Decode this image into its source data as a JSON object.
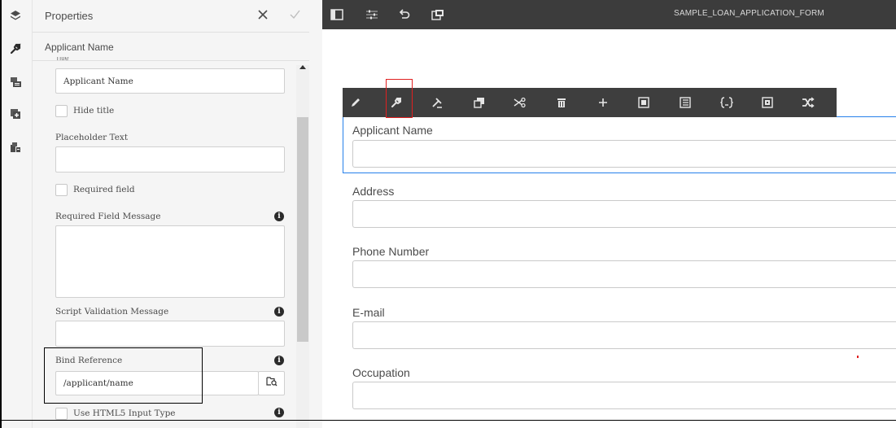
{
  "panel": {
    "title": "Properties",
    "subtitle": "Applicant Name",
    "cut_label": "Title",
    "fields": {
      "title_value": "Applicant Name",
      "hide_title_label": "Hide title",
      "placeholder_label": "Placeholder Text",
      "placeholder_value": "",
      "required_label": "Required field",
      "required_msg_label": "Required Field Message",
      "script_msg_label": "Script Validation Message",
      "bind_ref_label": "Bind Reference",
      "bind_ref_value": "/applicant/name",
      "html5_label": "Use HTML5 Input Type"
    }
  },
  "rail": {
    "icons": [
      "layers-icon",
      "wrench-icon",
      "components-icon",
      "add-asset-icon",
      "data-sources-icon"
    ]
  },
  "editor": {
    "form_title": "SAMPLE_LOAN_APPLICATION_FORM",
    "topbar_icons": [
      "toggle-panel-icon",
      "properties-icon",
      "undo-icon",
      "preview-icon"
    ],
    "component_toolbar": [
      "edit-icon",
      "wrench-icon",
      "style-icon",
      "copy-icon",
      "cut-icon",
      "delete-icon",
      "add-icon",
      "group-icon",
      "table-icon",
      "rules-icon",
      "select-parent-icon",
      "replace-icon"
    ],
    "fields": [
      {
        "label": "Applicant Name"
      },
      {
        "label": "Address"
      },
      {
        "label": "Phone Number"
      },
      {
        "label": "E-mail"
      },
      {
        "label": "Occupation"
      }
    ]
  },
  "colors": {
    "selection": "#2680eb",
    "highlight": "#e02020",
    "topbar": "#3c3c3c"
  }
}
